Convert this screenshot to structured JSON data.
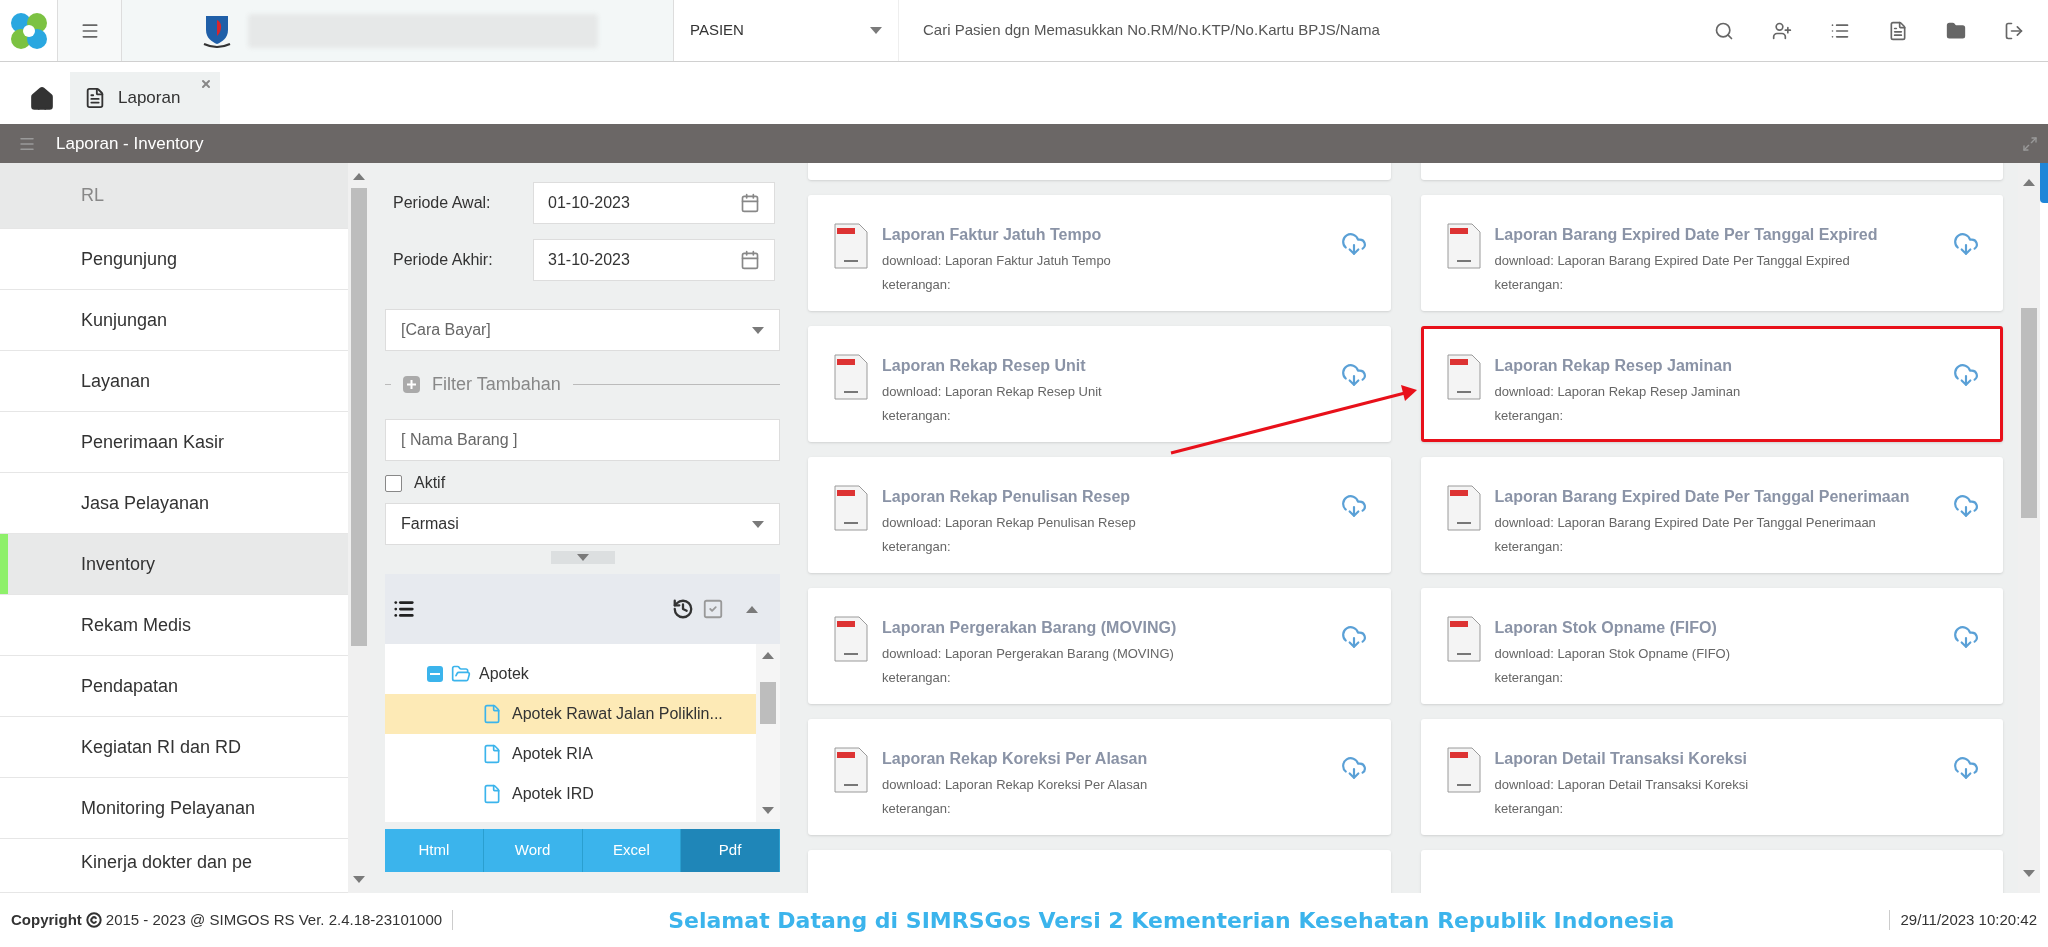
{
  "header": {
    "category": "PASIEN",
    "search": {
      "placeholder": "Cari Pasien dgn Memasukkan No.RM/No.KTP/No.Kartu BPJS/Nama"
    }
  },
  "tabs": [
    {
      "label": "Laporan",
      "selected": true
    }
  ],
  "panel": {
    "title": "Laporan - Inventory"
  },
  "sidebar": {
    "items": [
      {
        "label": "RL",
        "kind": "group",
        "selected": false
      },
      {
        "label": "Pengunjung",
        "kind": "item",
        "selected": false
      },
      {
        "label": "Kunjungan",
        "kind": "item",
        "selected": false
      },
      {
        "label": "Layanan",
        "kind": "item",
        "selected": false
      },
      {
        "label": "Penerimaan Kasir",
        "kind": "item",
        "selected": false
      },
      {
        "label": "Jasa Pelayanan",
        "kind": "item",
        "selected": false
      },
      {
        "label": "Inventory",
        "kind": "item",
        "selected": true
      },
      {
        "label": "Rekam Medis",
        "kind": "item",
        "selected": false
      },
      {
        "label": "Pendapatan",
        "kind": "item",
        "selected": false
      },
      {
        "label": "Kegiatan RI dan RD",
        "kind": "item",
        "selected": false
      },
      {
        "label": "Monitoring Pelayanan",
        "kind": "item",
        "selected": false
      },
      {
        "label": "Kinerja dokter dan pe",
        "kind": "item",
        "selected": false
      }
    ]
  },
  "filters": {
    "periode_awal": {
      "label": "Periode Awal:",
      "value": "01-10-2023"
    },
    "periode_akhir": {
      "label": "Periode Akhir:",
      "value": "31-10-2023"
    },
    "cara_bayar": {
      "placeholder": "[Cara Bayar]"
    },
    "filter_tambahan": {
      "label": "Filter Tambahan",
      "expanded": false
    },
    "nama_barang": {
      "placeholder": "[ Nama Barang ]"
    },
    "aktif": {
      "label": "Aktif",
      "checked": false
    },
    "depo": {
      "value": "Farmasi"
    }
  },
  "tree": {
    "items": [
      {
        "label": "Apotek",
        "expanded": true,
        "selected": false,
        "children": [
          {
            "label": "Apotek Rawat Jalan Poliklin...",
            "selected": true
          },
          {
            "label": "Apotek RIA",
            "selected": false
          },
          {
            "label": "Apotek IRD",
            "selected": false
          }
        ]
      }
    ]
  },
  "formats": [
    {
      "label": "Html",
      "selected": false
    },
    {
      "label": "Word",
      "selected": false
    },
    {
      "label": "Excel",
      "selected": false
    },
    {
      "label": "Pdf",
      "selected": true
    }
  ],
  "reports": [
    {
      "title": "Laporan Faktur Jatuh Tempo",
      "download": "download: Laporan Faktur Jatuh Tempo",
      "note": "keterangan:",
      "highlighted": false
    },
    {
      "title": "Laporan Barang Expired Date Per Tanggal Expired",
      "download": "download: Laporan Barang Expired Date Per Tanggal Expired",
      "note": "keterangan:",
      "highlighted": false
    },
    {
      "title": "Laporan Rekap Resep Unit",
      "download": "download: Laporan Rekap Resep Unit",
      "note": "keterangan:",
      "highlighted": false
    },
    {
      "title": "Laporan Rekap Resep Jaminan",
      "download": "download: Laporan Rekap Resep Jaminan",
      "note": "keterangan:",
      "highlighted": true
    },
    {
      "title": "Laporan Rekap Penulisan Resep",
      "download": "download: Laporan Rekap Penulisan Resep",
      "note": "keterangan:",
      "highlighted": false
    },
    {
      "title": "Laporan Barang Expired Date Per Tanggal Penerimaan",
      "download": "download: Laporan Barang Expired Date Per Tanggal Penerimaan",
      "note": "keterangan:",
      "highlighted": false
    },
    {
      "title": "Laporan Pergerakan Barang (MOVING)",
      "download": "download: Laporan Pergerakan Barang (MOVING)",
      "note": "keterangan:",
      "highlighted": false
    },
    {
      "title": "Laporan Stok Opname (FIFO)",
      "download": "download: Laporan Stok Opname (FIFO)",
      "note": "keterangan:",
      "highlighted": false
    },
    {
      "title": "Laporan Rekap Koreksi Per Alasan",
      "download": "download: Laporan Rekap Koreksi Per Alasan",
      "note": "keterangan:",
      "highlighted": false
    },
    {
      "title": "Laporan Detail Transaksi Koreksi",
      "download": "download: Laporan Detail Transaksi Koreksi",
      "note": "keterangan:",
      "highlighted": false
    }
  ],
  "footer": {
    "copyright_label": "Copyright",
    "copyright": "2015 - 2023 @ SIMGOS RS Ver. 2.4.18-23101000",
    "marquee": "Selamat Datang di SIMRSGos Versi 2 Kementerian Kesehatan Republik Indonesia",
    "datetime": "29/11/2023 10:20:42"
  }
}
